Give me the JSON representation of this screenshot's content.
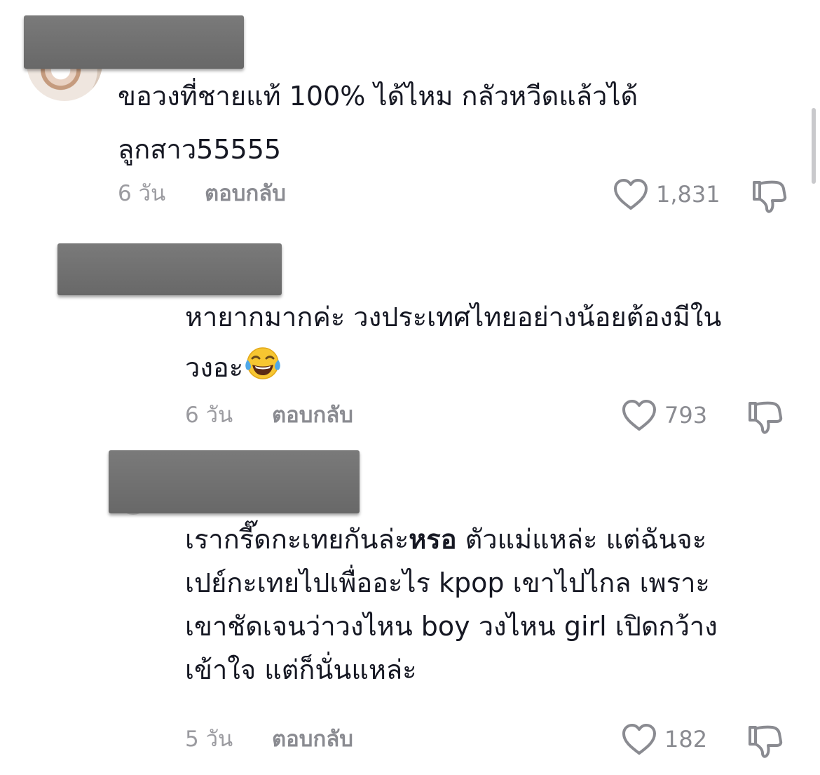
{
  "comments": [
    {
      "text_line1": "ขอวงที่ชายแท้ 100% ได้ไหม กลัวหวีดแล้วได้",
      "text_line2": "ลูกสาว55555",
      "date": "6 วัน",
      "reply_label": "ตอบกลับ",
      "likes": "1,831"
    },
    {
      "text_line1": "หายากมากค่ะ วงประเทศไทยอย่างน้อยต้องมีใน",
      "text_line2": "วงอะ",
      "emoji": "face-with-tears-of-joy",
      "date": "6 วัน",
      "reply_label": "ตอบกลับ",
      "likes": "793"
    },
    {
      "text_line1_a": "เรากรี๊ดกะเทยกันล่ะ",
      "text_line1_b": "หรอ",
      "text_line1_c": " ตัวแม่แหล่ะ แต่ฉันจะ",
      "text_line2": "เปย์กะเทยไปเพื่ออะไร kpop เขาไปไกล เพราะ",
      "text_line3": "เขาชัดเจนว่าวงไหน boy วงไหน girl เปิดกว้าง",
      "text_line4": "เข้าใจ แต่ก็นั่นแหล่ะ",
      "date": "5 วัน",
      "reply_label": "ตอบกลับ",
      "likes": "182"
    }
  ],
  "icons": {
    "like": "heart-outline-icon",
    "dislike": "thumbs-down-outline-icon"
  },
  "colors": {
    "text": "#161823",
    "meta": "#8a8b91",
    "redaction": "#707070"
  }
}
